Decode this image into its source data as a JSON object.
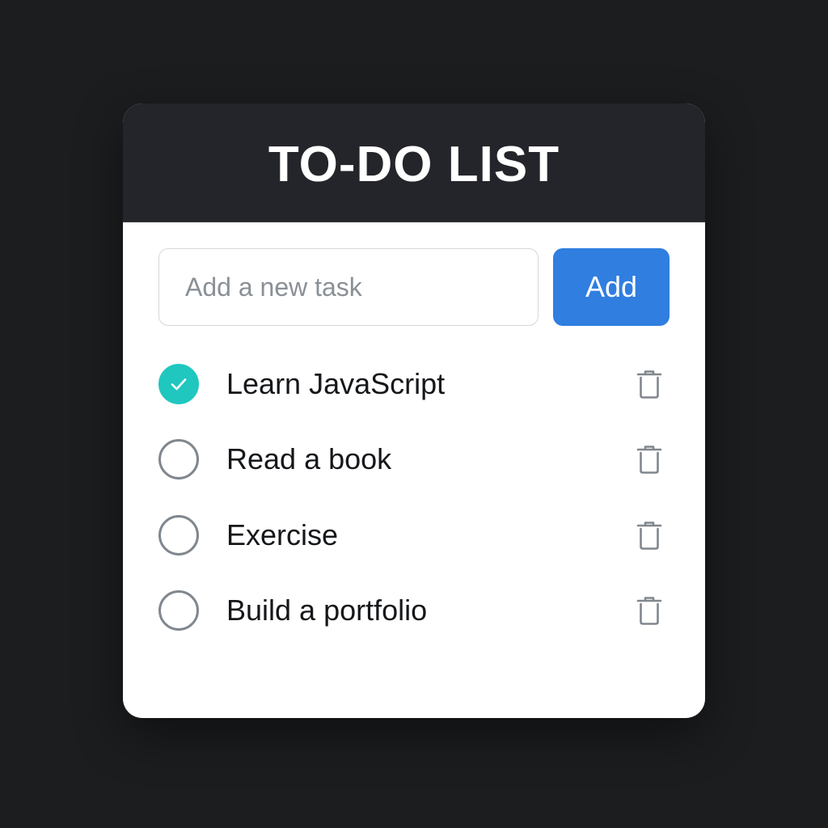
{
  "app": {
    "title": "TO-DO LIST"
  },
  "add_form": {
    "placeholder": "Add a new task",
    "value": "",
    "button_label": "Add"
  },
  "tasks": [
    {
      "label": "Learn JavaScript",
      "completed": true
    },
    {
      "label": "Read a book",
      "completed": false
    },
    {
      "label": "Exercise",
      "completed": false
    },
    {
      "label": "Build a portfolio",
      "completed": false
    }
  ],
  "icons": {
    "check": "check-icon",
    "delete": "trash-icon"
  },
  "colors": {
    "background": "#1c1d1f",
    "header": "#23252a",
    "accent_button": "#2f7ee0",
    "checked": "#1fc7bf",
    "unchecked_border": "#80878e"
  }
}
